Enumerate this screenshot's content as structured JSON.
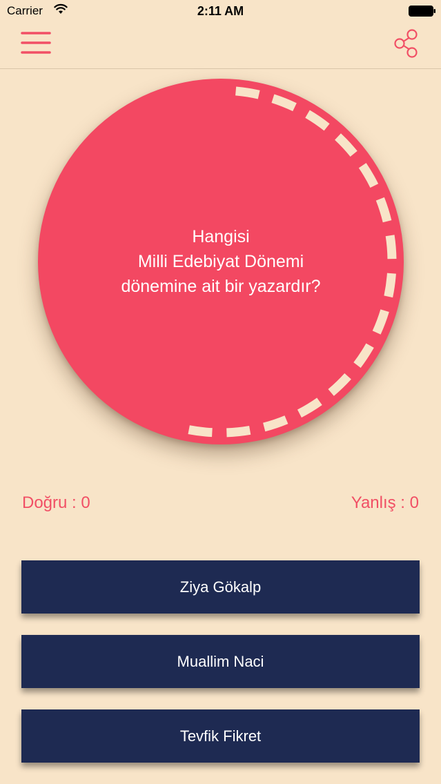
{
  "status_bar": {
    "carrier": "Carrier",
    "time": "2:11 AM",
    "wifi_icon": "wifi-icon",
    "battery_icon": "battery-icon"
  },
  "nav": {
    "menu_icon": "hamburger-menu-icon",
    "share_icon": "share-icon"
  },
  "question": {
    "line1": "Hangisi",
    "line2": "Milli Edebiyat Dönemi",
    "line3": "dönemine ait bir yazardır?"
  },
  "score": {
    "correct": "Doğru : 0",
    "wrong": "Yanlış : 0"
  },
  "answers": [
    {
      "label": "Ziya Gökalp"
    },
    {
      "label": "Muallim Naci"
    },
    {
      "label": "Tevfik Fikret"
    }
  ],
  "colors": {
    "background": "#f8e4c8",
    "accent": "#f34862",
    "button": "#1e2a52",
    "timer_dash": "#f8e4c8"
  },
  "timer": {
    "remaining_fraction": 0.55
  }
}
